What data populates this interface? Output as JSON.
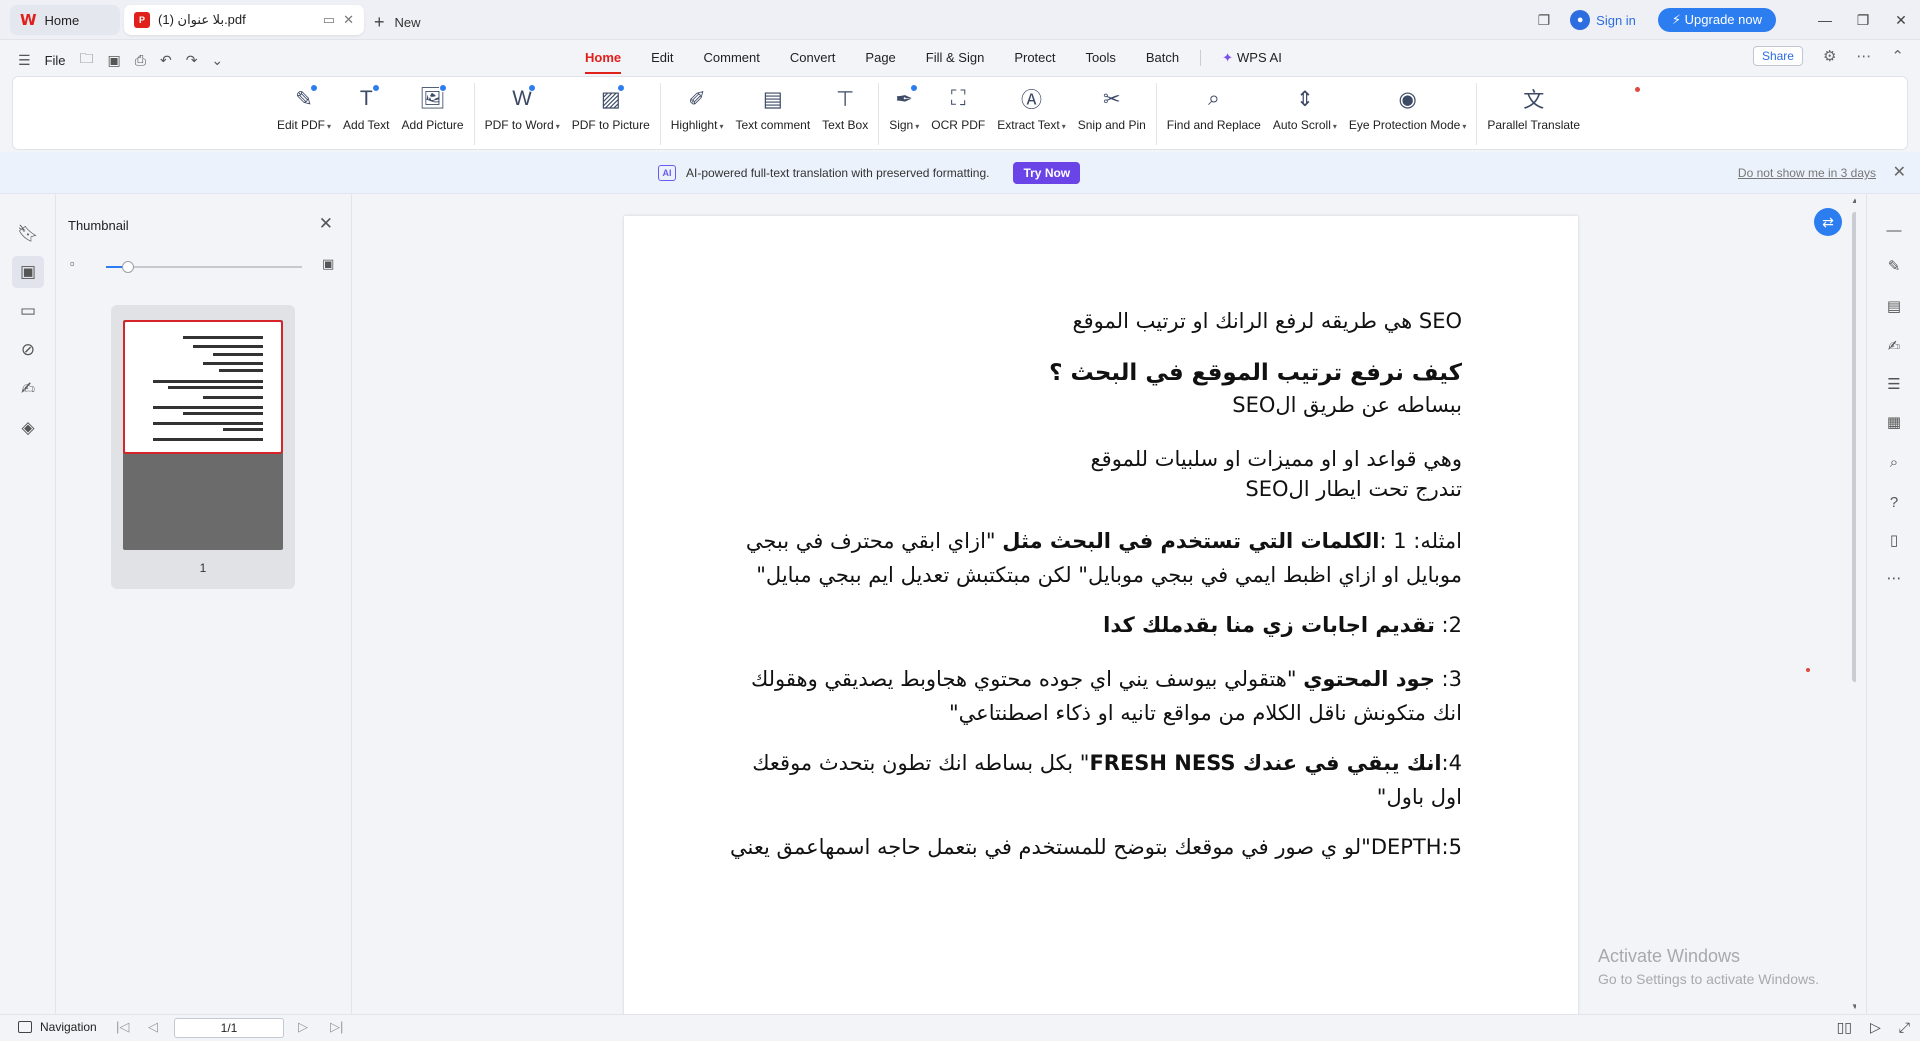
{
  "titlebar": {
    "home_tab": "Home",
    "doc_tab": "بلا عنوان (1).pdf",
    "new_tab": "New",
    "sign_in": "Sign in",
    "upgrade": "Upgrade now"
  },
  "menu": {
    "file": "File",
    "items": [
      "Home",
      "Edit",
      "Comment",
      "Convert",
      "Page",
      "Fill & Sign",
      "Protect",
      "Tools",
      "Batch"
    ],
    "wps_ai": "WPS AI",
    "share": "Share"
  },
  "ribbon": {
    "edit_pdf": "Edit PDF",
    "add_text": "Add Text",
    "add_picture": "Add Picture",
    "pdf_to_word": "PDF to Word",
    "pdf_to_picture": "PDF to Picture",
    "highlight": "Highlight",
    "text_comment": "Text comment",
    "text_box": "Text Box",
    "sign": "Sign",
    "ocr_pdf": "OCR PDF",
    "extract_text": "Extract Text",
    "snip_and_pin": "Snip and Pin",
    "find_and_replace": "Find and Replace",
    "auto_scroll": "Auto Scroll",
    "eye_protection": "Eye Protection Mode",
    "parallel_translate": "Parallel Translate"
  },
  "banner": {
    "message": "AI-powered full-text translation with preserved formatting.",
    "try_now": "Try Now",
    "dont_show": "Do not show me in 3 days"
  },
  "thumbnail": {
    "title": "Thumbnail",
    "page_number": "1",
    "zoom_fraction": 0.11
  },
  "document": {
    "l1": "SEO هي طريقه لرفع الرانك او ترتيب الموقع",
    "l2": "كيف نرفع ترتيب الموقع في البحث ؟",
    "l3": "ببساطه عن طريق الSEO",
    "l4": "وهي قواعد او او مميزات او سلبيات للموقع",
    "l5": "تندرج تحت ايطار الSEO",
    "l6_prefix": "امثله: 1 :",
    "l6_bold": "الكلمات التي تستخدم في البحث مثل",
    "l6_rest": " \"ازاي ابقي محترف في ببجي موبايل او ازاي اظبط ايمي في ببجي موبايل\" لكن مبتكتبش تعديل ايم ببجي مبايل\"",
    "l7_prefix": "2: ",
    "l7_bold": "تقديم اجابات زي منا بقدملك كدا",
    "l8_prefix": "3: ",
    "l8_bold": "جود المحتوي",
    "l8_rest": " \"هتقولي بيوسف يني اي جوده محتوي هجاوبط يصديقي وهقولك انك متكونش ناقل الكلام من مواقع تانيه او ذكاء اصطنتاعي\"",
    "l9_prefix": "4:",
    "l9_bold": "انك يبقي في عندك FRESH NESS",
    "l9_rest": "\" بكل بساطه انك تطون بتحدث موقعك اول باول\"",
    "l10": "DEPTH:5\"لو ي صور في موقعك بتوضح للمستخدم في بتعمل حاجه اسمهاعمق يعني"
  },
  "watermark": {
    "line1": "Activate Windows",
    "line2": "Go to Settings to activate Windows."
  },
  "status": {
    "navigation": "Navigation",
    "page": "1/1"
  },
  "colors": {
    "accent_red": "#e0211b",
    "accent_blue": "#2c7df0",
    "ai_purple": "#6b44e8"
  }
}
